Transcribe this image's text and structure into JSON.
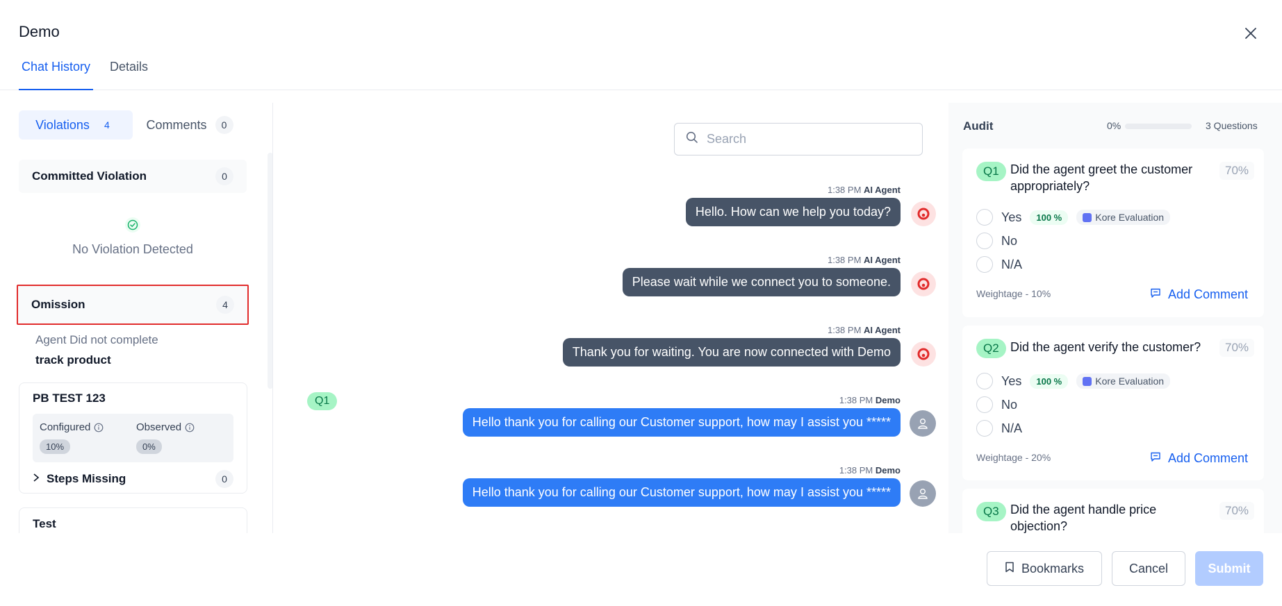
{
  "header": {
    "title": "Demo",
    "tabs": [
      {
        "label": "Chat History",
        "active": true
      },
      {
        "label": "Details",
        "active": false
      }
    ]
  },
  "left": {
    "segments": [
      {
        "label": "Violations",
        "count": "4",
        "active": true
      },
      {
        "label": "Comments",
        "count": "0",
        "active": false
      }
    ],
    "committed": {
      "label": "Committed Violation",
      "count": "0"
    },
    "no_violation_text": "No Violation Detected",
    "omission": {
      "label": "Omission",
      "count": "4"
    },
    "agent_line1": "Agent Did not complete",
    "agent_line2": "track product",
    "pb_card": {
      "title": "PB TEST 123",
      "configured_label": "Configured",
      "configured_value": "10%",
      "observed_label": "Observed",
      "observed_value": "0%",
      "steps_label": "Steps Missing",
      "steps_count": "0"
    },
    "test_card": {
      "title": "Test"
    }
  },
  "chat": {
    "search_placeholder": "Search",
    "q_tag": "Q1",
    "messages": [
      {
        "time": "1:38 PM",
        "sender": "AI Agent",
        "text": "Hello. How can we help you today?",
        "type": "ai"
      },
      {
        "time": "1:38 PM",
        "sender": "AI Agent",
        "text": "Please wait while we connect you to someone.",
        "type": "ai"
      },
      {
        "time": "1:38 PM",
        "sender": "AI Agent",
        "text": "Thank you for waiting. You are now connected with Demo",
        "type": "ai"
      },
      {
        "time": "1:38 PM",
        "sender": "Demo",
        "text": "Hello thank you for calling our Customer support, how may I assist you *****",
        "type": "user"
      },
      {
        "time": "1:38 PM",
        "sender": "Demo",
        "text": "Hello thank you for calling our Customer support, how may I assist you *****",
        "type": "user"
      }
    ]
  },
  "audit": {
    "title": "Audit",
    "progress": "0%",
    "questions_count": "3 Questions",
    "questions": [
      {
        "badge": "Q1",
        "text": "Did the agent greet the customer appropriately?",
        "pct": "70%",
        "options": [
          {
            "label": "Yes",
            "pct": "100 %",
            "eval": "Kore Evaluation"
          },
          {
            "label": "No"
          },
          {
            "label": "N/A"
          }
        ],
        "weightage": "Weightage - 10%",
        "comment": "Add Comment"
      },
      {
        "badge": "Q2",
        "text": "Did the agent verify the customer?",
        "pct": "70%",
        "options": [
          {
            "label": "Yes",
            "pct": "100 %",
            "eval": "Kore Evaluation"
          },
          {
            "label": "No"
          },
          {
            "label": "N/A"
          }
        ],
        "weightage": "Weightage - 20%",
        "comment": "Add Comment"
      },
      {
        "badge": "Q3",
        "text": "Did the agent handle price objection?",
        "pct": "70%"
      }
    ]
  },
  "footer": {
    "bookmarks": "Bookmarks",
    "cancel": "Cancel",
    "submit": "Submit"
  },
  "colors": {
    "accent": "#155eef",
    "ai_bubble": "#475467",
    "user_bubble": "#2e7cf6",
    "highlight_border": "#e12b2b",
    "q_badge": "#a6f4c5"
  }
}
